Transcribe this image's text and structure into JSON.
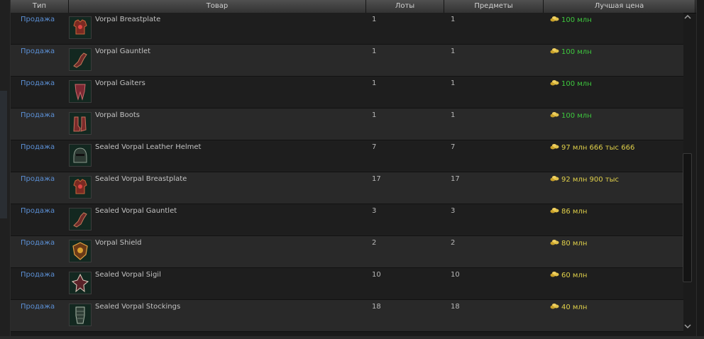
{
  "header": {
    "type": "Тип",
    "item": "Товар",
    "lots": "Лоты",
    "items": "Предметы",
    "best_price": "Лучшая цена"
  },
  "colors": {
    "link": "#5b8fd4",
    "price_green": "#3ec83e",
    "price_yellow": "#e0d04a"
  },
  "rows": [
    {
      "type": "Продажа",
      "name": "Vorpal Breastplate",
      "lots": "1",
      "items": "1",
      "price": "100 млн",
      "price_color": "#3ec83e",
      "icon": "breastplate-icon"
    },
    {
      "type": "Продажа",
      "name": "Vorpal Gauntlet",
      "lots": "1",
      "items": "1",
      "price": "100 млн",
      "price_color": "#3ec83e",
      "icon": "gauntlet-icon"
    },
    {
      "type": "Продажа",
      "name": "Vorpal Gaiters",
      "lots": "1",
      "items": "1",
      "price": "100 млн",
      "price_color": "#3ec83e",
      "icon": "gaiters-icon"
    },
    {
      "type": "Продажа",
      "name": "Vorpal Boots",
      "lots": "1",
      "items": "1",
      "price": "100 млн",
      "price_color": "#3ec83e",
      "icon": "boots-icon"
    },
    {
      "type": "Продажа",
      "name": "Sealed Vorpal Leather Helmet",
      "lots": "7",
      "items": "7",
      "price": "97 млн 666 тыс 666",
      "price_color": "#e0d04a",
      "icon": "helmet-icon"
    },
    {
      "type": "Продажа",
      "name": "Sealed Vorpal Breastplate",
      "lots": "17",
      "items": "17",
      "price": "92 млн 900 тыс",
      "price_color": "#e0d04a",
      "icon": "breastplate-icon"
    },
    {
      "type": "Продажа",
      "name": "Sealed Vorpal Gauntlet",
      "lots": "3",
      "items": "3",
      "price": "86 млн",
      "price_color": "#e0d04a",
      "icon": "gauntlet-icon"
    },
    {
      "type": "Продажа",
      "name": "Vorpal Shield",
      "lots": "2",
      "items": "2",
      "price": "80 млн",
      "price_color": "#e0d04a",
      "icon": "shield-icon"
    },
    {
      "type": "Продажа",
      "name": "Sealed Vorpal Sigil",
      "lots": "10",
      "items": "10",
      "price": "60 млн",
      "price_color": "#e0d04a",
      "icon": "sigil-icon"
    },
    {
      "type": "Продажа",
      "name": "Sealed Vorpal Stockings",
      "lots": "18",
      "items": "18",
      "price": "40 млн",
      "price_color": "#e0d04a",
      "icon": "stockings-icon"
    }
  ],
  "scrollbar": {
    "up_icon": "chevron-up-icon",
    "down_icon": "chevron-down-icon"
  }
}
